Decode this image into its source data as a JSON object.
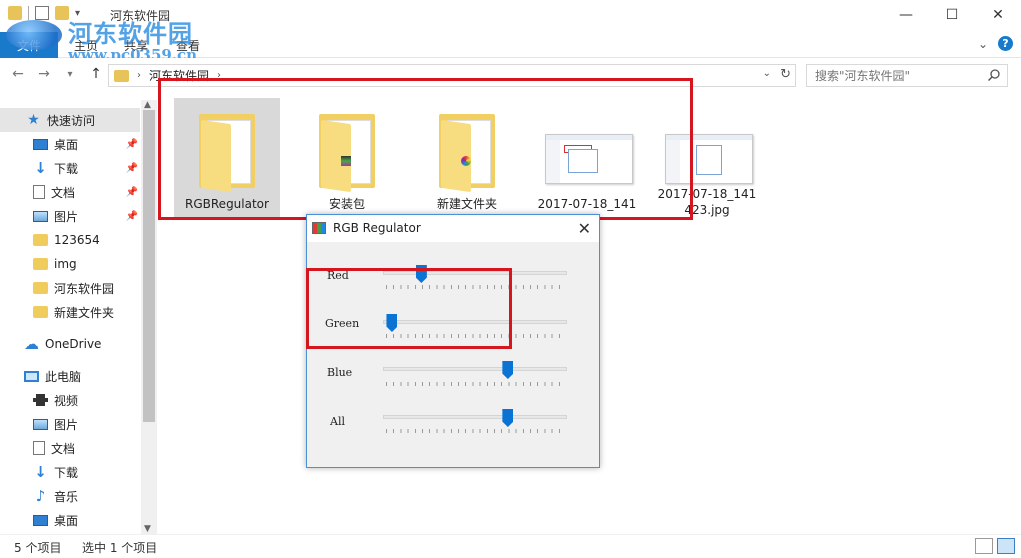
{
  "window": {
    "title": "河东软件园",
    "minimize": "—",
    "maximize": "☐",
    "close": "✕"
  },
  "watermark": {
    "title": "河东软件园",
    "url": "www.pc0359.cn"
  },
  "ribbon": {
    "file_tab": "文件",
    "tabs": [
      "主页",
      "共享",
      "查看"
    ],
    "collapse": "⌄",
    "help": "?"
  },
  "address": {
    "path": "河东软件园",
    "search_placeholder": "搜索\"河东软件园\""
  },
  "nav": {
    "quick_access": "快速访问",
    "items": [
      {
        "label": "桌面",
        "pinned": true
      },
      {
        "label": "下载",
        "pinned": true
      },
      {
        "label": "文档",
        "pinned": true
      },
      {
        "label": "图片",
        "pinned": true
      },
      {
        "label": "123654"
      },
      {
        "label": "img"
      },
      {
        "label": "河东软件园"
      },
      {
        "label": "新建文件夹"
      }
    ],
    "onedrive": "OneDrive",
    "this_pc": "此电脑",
    "pc_items": [
      "视频",
      "图片",
      "文档",
      "下载",
      "音乐",
      "桌面"
    ]
  },
  "files": [
    {
      "name": "RGBRegulator",
      "type": "folder",
      "selected": true
    },
    {
      "name": "安装包",
      "type": "folder"
    },
    {
      "name": "新建文件夹",
      "type": "folder"
    },
    {
      "name": "2017-07-18_141",
      "type": "image"
    },
    {
      "name": "2017-07-18_141\n423.jpg",
      "type": "image"
    }
  ],
  "rgb_window": {
    "title": "RGB Regulator",
    "close": "✕",
    "sliders": [
      {
        "label": "Red",
        "value": 0.19
      },
      {
        "label": "Green",
        "value": 0.02
      },
      {
        "label": "Blue",
        "value": 0.69
      },
      {
        "label": "All",
        "value": 0.69
      }
    ]
  },
  "status": {
    "count": "5 个项目",
    "selection": "选中 1 个项目"
  },
  "colors": {
    "accent": "#1979ca",
    "highlight_box": "#d6161f",
    "slider_thumb": "#0a73d4"
  }
}
